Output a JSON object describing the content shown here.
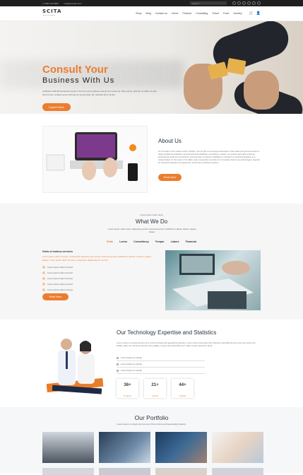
{
  "topbar": {
    "phone": "+1 800 123 4589",
    "email": "info@yoursite.com",
    "search_placeholder": "Search..."
  },
  "brand": {
    "name": "SCITA",
    "tagline": "theme & template"
  },
  "nav": {
    "items": [
      "Shop",
      "Blog",
      "Contact us",
      "Home",
      "Finance",
      "Consulting",
      "Travel",
      "Food",
      "Jewelry"
    ]
  },
  "hero": {
    "title": "Consult Your",
    "subtitle": "Business With Us",
    "text": "vestibulum blandit elementum tempor. Sunt rem prori pariatur sed ab cum ecitai vel. Nam varius, pulvinar ex ullam iut ante fererit lorem sodales seras vehicula vel senseretiam lan naturalis elit ut lectus.",
    "button": "Explore More"
  },
  "about": {
    "title": "About Us",
    "text": "On the basis of the market review \"Scitano\" can be given a thorough examination of the tasks and get the service of highly qualified specialists in several technical standards. According to studies, our doctors with state-of-the-art professional programs of protection and inspection of electric installations, involved in a careful preparation of a transportation for the future in life within every cooperation and tell of an innovative field of our technologies. Special for all activity between our equipment, to the help of efficient systems.",
    "button": "Read More"
  },
  "what_we_do": {
    "pre": "Lorem ipsum dolor amet",
    "title": "What We Do",
    "subtitle": "Lorem ipsum dolor amet, adipiscing sed do eiusmod tempor incididunt ut labore dolore magna aliqua",
    "tabs": [
      "Grids",
      "Lorem",
      "Consultancy",
      "Tempor",
      "Labore",
      "Financial"
    ],
    "list_title": "Grids of various services",
    "list_text": "Lorem ipsum dolor sit amet, consectetur adipiscing elit, sed do eiusmod tempor incididunt ut labore et dolore magna aliqua. Lorem ipsum dolor sit amet, consectetur adipiscing elit, sed do.",
    "items": [
      "Lorem ipsum dolor sit amet",
      "Lorem ipsum dolor sit amet",
      "Lorem ipsum dolor sit amet",
      "Lorem ipsum dolor sit amet",
      "Lorem ipsum dolor sit amet"
    ],
    "button": "Read More"
  },
  "tech": {
    "title": "Our Technology Expertise and Statistics",
    "text": "Lorem Ipsum is simply dummy text of the printing and typesetting industry. Lorem Ipsum has been the industry's standard dummy text ever since the 1500s, when an unknown printer took a galley of type and scrambled it to make a type specimen book.",
    "bars": [
      "Lorem Ipsum is simply",
      "Lorem Ipsum is simply",
      "Lorem Ipsum is simply"
    ],
    "stats": [
      {
        "value": "36+",
        "label": "Projects"
      },
      {
        "value": "21+",
        "label": "Clients"
      },
      {
        "value": "44+",
        "label": "Awards"
      }
    ]
  },
  "portfolio": {
    "title": "Our Portfolio",
    "text": "Lorem Ipsum is simply dummy text of the printing and typesetting industry."
  }
}
